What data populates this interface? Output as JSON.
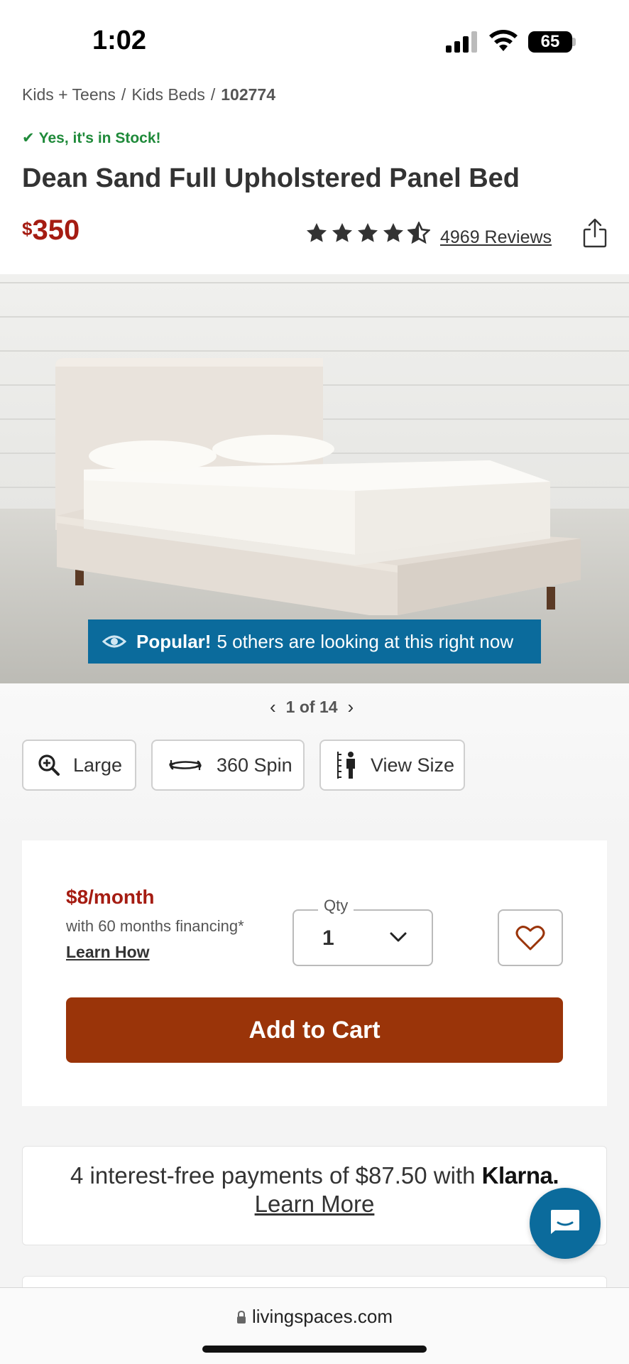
{
  "status": {
    "time": "1:02",
    "battery": "65"
  },
  "breadcrumb": {
    "items": [
      "Kids + Teens",
      "Kids Beds"
    ],
    "sku": "102774",
    "separator": "/"
  },
  "stock_text": "Yes, it's in Stock!",
  "product": {
    "title": "Dean Sand Full Upholstered Panel Bed",
    "currency": "$",
    "price": "350",
    "rating": 4.5,
    "reviews_label": "4969 Reviews"
  },
  "popular": {
    "bold": "Popular!",
    "text": "5 others are looking at this right now"
  },
  "gallery": {
    "pager": "1 of 14",
    "buttons": [
      "Large",
      "360 Spin",
      "View Size"
    ]
  },
  "purchase": {
    "monthly": "$8/month",
    "financing": "with 60 months financing*",
    "learn_how": "Learn How",
    "qty_label": "Qty",
    "qty_value": "1",
    "add_to_cart": "Add to Cart"
  },
  "klarna": {
    "text": "4 interest-free payments of $87.50 with",
    "brand": "Klarna.",
    "learn_more": "Learn More"
  },
  "url": "livingspaces.com",
  "colors": {
    "price_red": "#a51c12",
    "cart_brown": "#9a3409",
    "accent_blue": "#0b6b9c",
    "stock_green": "#1f8a3a"
  },
  "icons": [
    "check-icon",
    "star-icon",
    "half-star-icon",
    "share-icon",
    "eye-icon",
    "chevron-left-icon",
    "chevron-right-icon",
    "zoom-icon",
    "spin-icon",
    "ruler-person-icon",
    "chevron-down-icon",
    "heart-icon",
    "chat-icon",
    "lock-icon"
  ]
}
